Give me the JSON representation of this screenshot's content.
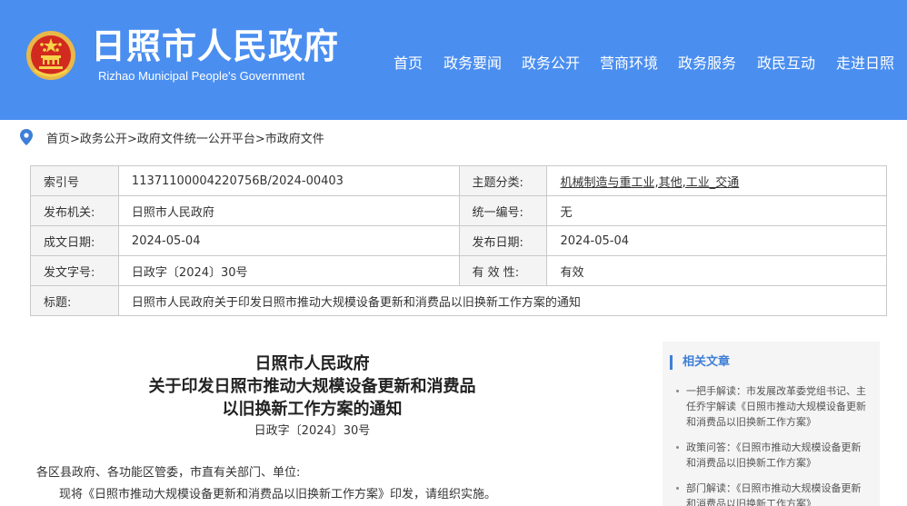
{
  "header": {
    "title": "日照市人民政府",
    "subtitle": "Rizhao Municipal People's Government",
    "nav": [
      "首页",
      "政务要闻",
      "政务公开",
      "营商环境",
      "政务服务",
      "政民互动",
      "走进日照"
    ]
  },
  "breadcrumb": {
    "items": [
      "首页",
      "政务公开",
      "政府文件统一公开平台",
      "市政府文件"
    ],
    "separator": ">"
  },
  "meta": {
    "rows": [
      {
        "k1": "索引号",
        "v1": "11371100004220756B/2024-00403",
        "k2": "主题分类:",
        "v2": "机械制造与重工业,其他,工业_交通"
      },
      {
        "k1": "发布机关:",
        "v1": "日照市人民政府",
        "k2": "统一编号:",
        "v2": "无"
      },
      {
        "k1": "成文日期:",
        "v1": "2024-05-04",
        "k2": "发布日期:",
        "v2": "2024-05-04"
      },
      {
        "k1": "发文字号:",
        "v1": "日政字〔2024〕30号",
        "k2": "有 效 性:",
        "v2": "有效"
      }
    ],
    "title_label": "标题:",
    "title_value": "日照市人民政府关于印发日照市推动大规模设备更新和消费品以旧换新工作方案的通知"
  },
  "article": {
    "title_lines": [
      "日照市人民政府",
      "关于印发日照市推动大规模设备更新和消费品",
      "以旧换新工作方案的通知"
    ],
    "doc_no": "日政字〔2024〕30号",
    "salutation": "各区县政府、各功能区管委，市直有关部门、单位:",
    "body": "现将《日照市推动大规模设备更新和消费品以旧换新工作方案》印发，请组织实施。"
  },
  "related": {
    "heading": "相关文章",
    "items": [
      "一把手解读：市发展改革委党组书记、主任乔宇解读《日照市推动大规模设备更新和消费品以旧换新工作方案》",
      "政策问答：《日照市推动大规模设备更新和消费品以旧换新工作方案》",
      "部门解读：《日照市推动大规模设备更新和消费品以旧换新工作方案》"
    ]
  },
  "colors": {
    "header_bg": "#4a8ef0",
    "accent": "#3f7fd6"
  }
}
